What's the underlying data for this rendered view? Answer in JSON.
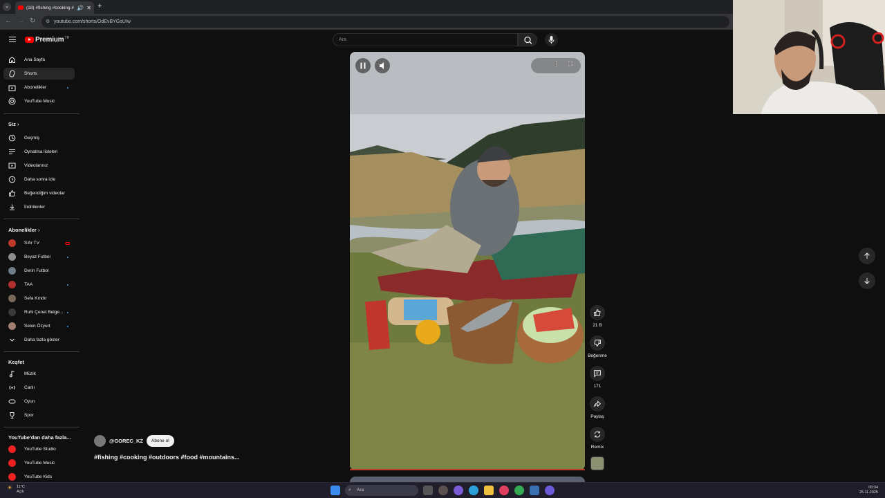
{
  "browser": {
    "tab_title": "(18) #fishing #cooking #outdoors",
    "url": "youtube.com/shorts/OdEvBYGsUIw"
  },
  "header": {
    "logo_text": "Premium",
    "logo_region": "TR",
    "search_placeholder": "Ara"
  },
  "sidebar": {
    "main": [
      {
        "label": "Ana Sayfa",
        "icon": "home-icon"
      },
      {
        "label": "Shorts",
        "icon": "shorts-icon",
        "active": true
      },
      {
        "label": "Abonelikler",
        "icon": "subscriptions-icon"
      },
      {
        "label": "YouTube Music",
        "icon": "music-icon"
      }
    ],
    "you_heading": "Siz",
    "you": [
      {
        "label": "Geçmiş",
        "icon": "history-icon"
      },
      {
        "label": "Oynatma listeleri",
        "icon": "playlists-icon"
      },
      {
        "label": "Videolarınız",
        "icon": "your-videos-icon"
      },
      {
        "label": "Daha sonra izle",
        "icon": "watch-later-icon"
      },
      {
        "label": "Beğendiğim videolar",
        "icon": "liked-icon"
      },
      {
        "label": "İndirilenler",
        "icon": "downloads-icon"
      }
    ],
    "subs_heading": "Abonelikler",
    "subs": [
      {
        "label": "Sıfır TV",
        "color": "#c0392b",
        "live": true
      },
      {
        "label": "Beyaz Futbol",
        "color": "#8e8e8e",
        "dot": true
      },
      {
        "label": "Derin Futbol",
        "color": "#6f7b86"
      },
      {
        "label": "TAA",
        "color": "#b03030",
        "dot": true
      },
      {
        "label": "Sefa Kındır",
        "color": "#7a6a5a"
      },
      {
        "label": "Ruhi Çenet Belge...",
        "color": "#3a3a3a",
        "dot": true
      },
      {
        "label": "Selen Özyurt",
        "color": "#a08070",
        "dot": true
      }
    ],
    "show_more": "Daha fazla göster",
    "explore_heading": "Keşfet",
    "explore": [
      {
        "label": "Müzik",
        "icon": "music-note-icon"
      },
      {
        "label": "Canlı",
        "icon": "live-icon"
      },
      {
        "label": "Oyun",
        "icon": "gaming-icon"
      },
      {
        "label": "Spor",
        "icon": "trophy-icon"
      }
    ],
    "more_heading": "YouTube'dan daha fazla...",
    "more": [
      {
        "label": "YouTube Studio"
      },
      {
        "label": "YouTube Music"
      },
      {
        "label": "YouTube Kids"
      }
    ]
  },
  "short": {
    "channel": "@GOREC_KZ",
    "subscribe": "Abone ol",
    "description": "#fishing #cooking #outdoors #food #mountains...",
    "likes": "21 B",
    "dislike_label": "Beğenme",
    "comments": "171",
    "share_label": "Paylaş",
    "remix_label": "Remix"
  },
  "taskbar": {
    "weather_temp": "11°C",
    "weather_text": "Açık",
    "search_label": "Ara",
    "time": "00:34",
    "date": "25.11.2025"
  }
}
